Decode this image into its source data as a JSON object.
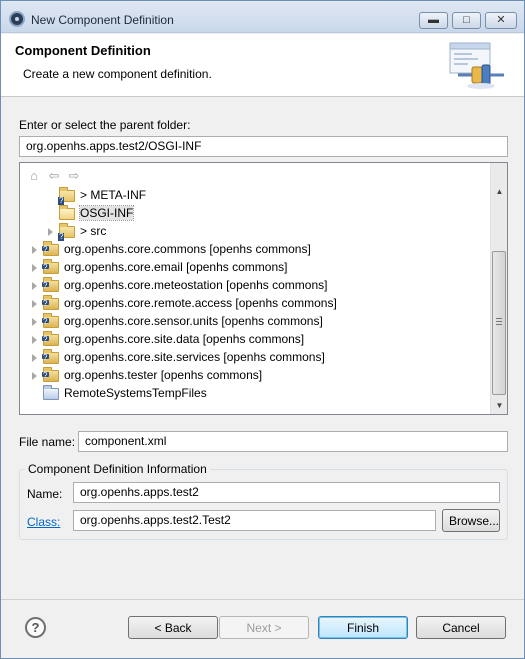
{
  "window": {
    "title": "New Component Definition"
  },
  "header": {
    "title": "Component Definition",
    "description": "Create a new component definition."
  },
  "parent_folder": {
    "label": "Enter or select the parent folder:",
    "value": "org.openhs.apps.test2/OSGI-INF"
  },
  "tree": {
    "items": [
      {
        "label": "> META-INF"
      },
      {
        "label": "OSGI-INF"
      },
      {
        "label": "> src"
      },
      {
        "label": "org.openhs.core.commons  [openhs commons]"
      },
      {
        "label": "org.openhs.core.email  [openhs commons]"
      },
      {
        "label": "org.openhs.core.meteostation  [openhs commons]"
      },
      {
        "label": "org.openhs.core.remote.access  [openhs commons]"
      },
      {
        "label": "org.openhs.core.sensor.units  [openhs commons]"
      },
      {
        "label": "org.openhs.core.site.data  [openhs commons]"
      },
      {
        "label": "org.openhs.core.site.services  [openhs commons]"
      },
      {
        "label": "org.openhs.tester  [openhs commons]"
      },
      {
        "label": "RemoteSystemsTempFiles"
      }
    ]
  },
  "file_name": {
    "label": "File name:",
    "value": "component.xml"
  },
  "info_group": {
    "title": "Component Definition Information",
    "name_label": "Name:",
    "name_value": "org.openhs.apps.test2",
    "class_label": "Class:",
    "class_value": "org.openhs.apps.test2.Test2",
    "browse_label": "Browse..."
  },
  "buttons": {
    "back": "< Back",
    "next": "Next >",
    "finish": "Finish",
    "cancel": "Cancel"
  },
  "icons": {
    "minimize": "minimize-icon",
    "maximize": "maximize-icon",
    "close": "close-icon",
    "help": "help-icon"
  }
}
